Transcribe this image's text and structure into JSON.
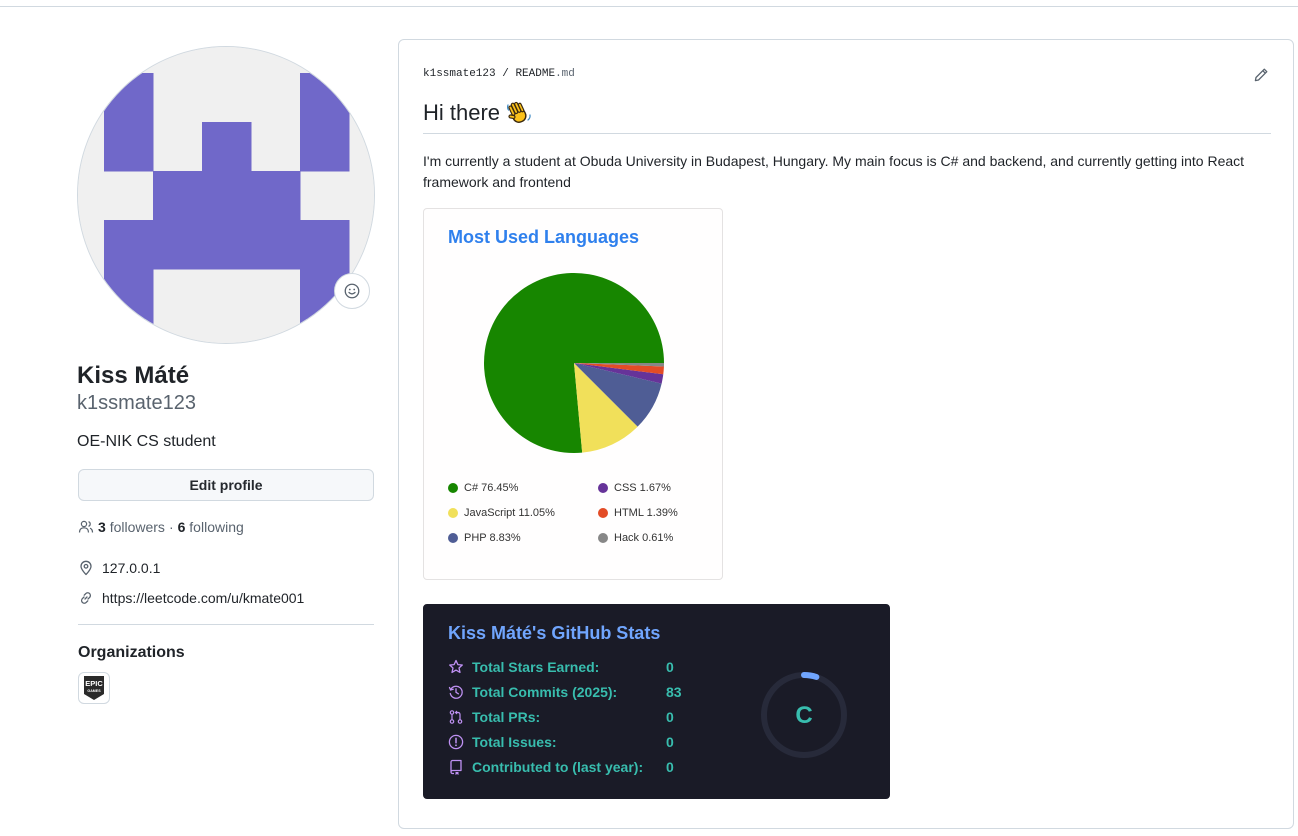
{
  "profile": {
    "full_name": "Kiss Máté",
    "username": "k1ssmate123",
    "bio": "OE-NIK CS student",
    "edit_label": "Edit profile",
    "followers_count": "3",
    "followers_label": "followers",
    "separator": "·",
    "following_count": "6",
    "following_label": "following",
    "location": "127.0.0.1",
    "website": "https://leetcode.com/u/kmate001",
    "organizations_title": "Organizations",
    "avatar_color": "#7068c9"
  },
  "readme": {
    "breadcrumb_user": "k1ssmate123",
    "breadcrumb_sep": "/",
    "breadcrumb_file": "README",
    "breadcrumb_ext": ".md",
    "heading": "Hi there",
    "paragraph": "I'm currently a student at Obuda University in Budapest, Hungary. My main focus is C# and backend, and currently getting into React framework and frontend"
  },
  "languages_card": {
    "title": "Most Used Languages",
    "legend": [
      {
        "label": "C# 76.45%",
        "color": "#178600"
      },
      {
        "label": "CSS 1.67%",
        "color": "#663399"
      },
      {
        "label": "JavaScript 11.05%",
        "color": "#f1e05a"
      },
      {
        "label": "HTML 1.39%",
        "color": "#e34c26"
      },
      {
        "label": "PHP 8.83%",
        "color": "#4F5D95"
      },
      {
        "label": "Hack 0.61%",
        "color": "#878787"
      }
    ]
  },
  "chart_data": {
    "type": "pie",
    "title": "Most Used Languages",
    "categories": [
      "C#",
      "JavaScript",
      "PHP",
      "CSS",
      "HTML",
      "Hack"
    ],
    "values": [
      76.45,
      11.05,
      8.83,
      1.67,
      1.39,
      0.61
    ],
    "colors": [
      "#178600",
      "#f1e05a",
      "#4F5D95",
      "#663399",
      "#e34c26",
      "#878787"
    ],
    "legend": "bottom"
  },
  "stats_card": {
    "title": "Kiss Máté's GitHub Stats",
    "rows": [
      {
        "label": "Total Stars Earned:",
        "value": "0",
        "icon": "star-icon"
      },
      {
        "label": "Total Commits (2025):",
        "value": "83",
        "icon": "commits-icon"
      },
      {
        "label": "Total PRs:",
        "value": "0",
        "icon": "pull-request-icon"
      },
      {
        "label": "Total Issues:",
        "value": "0",
        "icon": "issue-icon"
      },
      {
        "label": "Contributed to (last year):",
        "value": "0",
        "icon": "repo-icon"
      }
    ],
    "rank": "C",
    "rank_progress": 0.05
  }
}
